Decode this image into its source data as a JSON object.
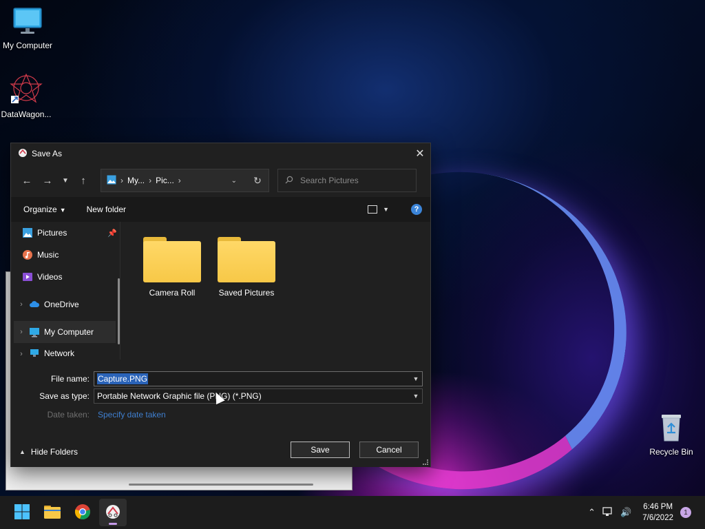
{
  "desktop": {
    "icons": [
      {
        "label": "My Computer"
      },
      {
        "label": "DataWagon..."
      },
      {
        "label": "Recycle Bin"
      }
    ]
  },
  "dialog": {
    "title": "Save As",
    "breadcrumb": [
      "My...",
      "Pic..."
    ],
    "search_placeholder": "Search Pictures",
    "commands": {
      "organize": "Organize",
      "new_folder": "New folder"
    },
    "nav_items": [
      {
        "label": "Pictures",
        "pinned": true
      },
      {
        "label": "Music"
      },
      {
        "label": "Videos"
      },
      {
        "label": "OneDrive"
      },
      {
        "label": "My Computer"
      },
      {
        "label": "Network"
      }
    ],
    "folders": [
      {
        "label": "Camera Roll"
      },
      {
        "label": "Saved Pictures"
      }
    ],
    "form": {
      "file_name_label": "File name:",
      "file_name_value": "Capture.PNG",
      "save_type_label": "Save as type:",
      "save_type_value": "Portable Network Graphic file (PNG) (*.PNG)",
      "date_taken_label": "Date taken:",
      "date_taken_link": "Specify date taken"
    },
    "hide_folders": "Hide Folders",
    "save_label": "Save",
    "cancel_label": "Cancel"
  },
  "taskbar": {
    "time": "6:46 PM",
    "date": "7/6/2022",
    "notification_count": "1"
  },
  "colors": {
    "accent_blue": "#3b84d8",
    "folder_yellow": "#f7c847",
    "selection": "#2a63b8"
  }
}
